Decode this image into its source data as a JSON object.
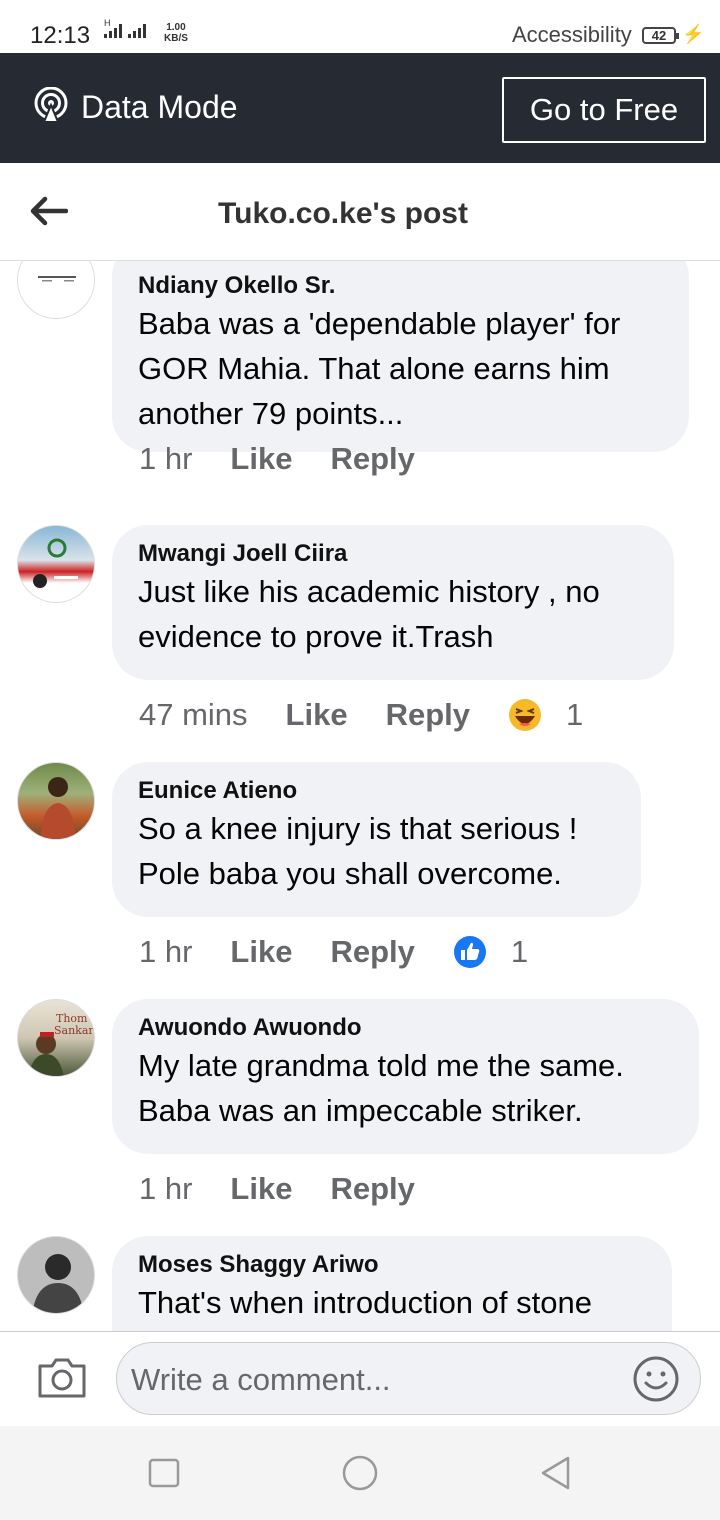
{
  "status_bar": {
    "time": "12:13",
    "network_label": "H",
    "speed_value": "1.00",
    "speed_unit": "KB/S",
    "accessibility": "Accessibility",
    "battery": "42"
  },
  "data_mode_bar": {
    "label": "Data Mode",
    "button": "Go to Free"
  },
  "header": {
    "title": "Tuko.co.ke's post"
  },
  "comments": [
    {
      "author": "Ndiany Okello Sr.",
      "text": "Baba was a 'dependable player' for GOR Mahia. That alone earns him another 79 points...",
      "time": "1 hr",
      "like": "Like",
      "reply": "Reply"
    },
    {
      "author": "Mwangi Joell Ciira",
      "text": "Just like his academic history , no evidence to prove it.Trash",
      "time": "47 mins",
      "like": "Like",
      "reply": "Reply",
      "reaction": {
        "icon": "haha-emoji-icon",
        "count": "1"
      }
    },
    {
      "author": "Eunice Atieno",
      "text": "So a knee injury is that serious ! Pole baba you shall overcome.",
      "time": "1 hr",
      "like": "Like",
      "reply": "Reply",
      "reaction": {
        "icon": "thumbs-up-icon",
        "count": "1"
      }
    },
    {
      "author": "Awuondo Awuondo",
      "text": "My late grandma told me the same. Baba was an impeccable striker.",
      "time": "1 hr",
      "like": "Like",
      "reply": "Reply"
    },
    {
      "author": "Moses Shaggy Ariwo",
      "text": "That's when introduction of stone"
    }
  ],
  "compose": {
    "placeholder": "Write a comment..."
  },
  "colors": {
    "data_bar_bg": "#252a33",
    "bubble_bg": "#f0f2f5",
    "meta_text": "#65676b",
    "like_blue": "#1877f2",
    "haha_yellow": "#f7b928"
  }
}
